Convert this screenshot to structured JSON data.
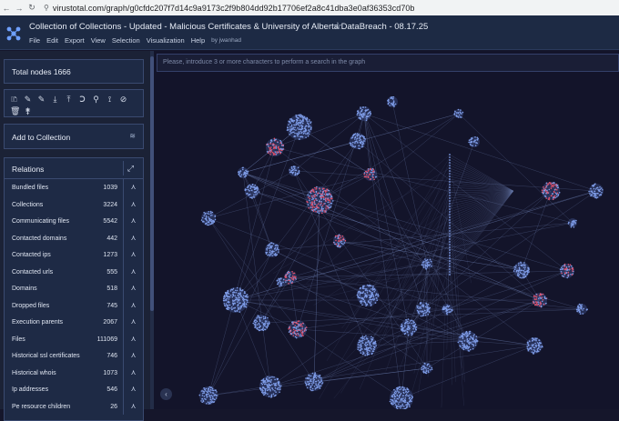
{
  "browser": {
    "url": "virustotal.com/graph/g0cfdc207f7d14c9a9173c2f9b804dd92b17706ef2a8c41dba3e0af36353cd70b",
    "back_icon": "←",
    "forward_icon": "→",
    "reload_icon": "↻",
    "site_icon": "⚲"
  },
  "app": {
    "title": "Collection of Collections - Updated - Malicious Certificates & University of Alberta DataBreach - 08.17.25",
    "star_icon": "☆",
    "menu": [
      "File",
      "Edit",
      "Export",
      "View",
      "Selection",
      "Visualization",
      "Help"
    ],
    "by": "by jwanhad"
  },
  "sidebar": {
    "total_nodes": "Total nodes 1666",
    "tools": [
      "🗈",
      "✎",
      "✎",
      "⤓",
      "⤒",
      "Ↄ",
      "⚲",
      "⟟",
      "⊘",
      "🗑",
      "⚵"
    ],
    "add_to_collection": "Add to Collection",
    "relations_title": "Relations",
    "relations": [
      {
        "label": "Bundled files",
        "count": "1039"
      },
      {
        "label": "Collections",
        "count": "3224"
      },
      {
        "label": "Communicating files",
        "count": "5542"
      },
      {
        "label": "Contacted domains",
        "count": "442"
      },
      {
        "label": "Contacted ips",
        "count": "1273"
      },
      {
        "label": "Contacted urls",
        "count": "555"
      },
      {
        "label": "Domains",
        "count": "518"
      },
      {
        "label": "Dropped files",
        "count": "745"
      },
      {
        "label": "Execution parents",
        "count": "2067"
      },
      {
        "label": "Files",
        "count": "111069"
      },
      {
        "label": "Historical ssl certificates",
        "count": "746"
      },
      {
        "label": "Historical whois",
        "count": "1073"
      },
      {
        "label": "Ip addresses",
        "count": "546"
      },
      {
        "label": "Pe resource children",
        "count": "26"
      }
    ]
  },
  "graph": {
    "search_placeholder": "Please, introduce 3 or more characters to perform a search in the graph",
    "collapse_icon": "‹"
  },
  "colors": {
    "header_bg": "#1d2a44",
    "sidebar_bg": "#1b2236",
    "graph_bg": "#13142a",
    "node_blue": "#7f9de8",
    "node_red": "#e0506a",
    "edge": "#6677a8"
  }
}
